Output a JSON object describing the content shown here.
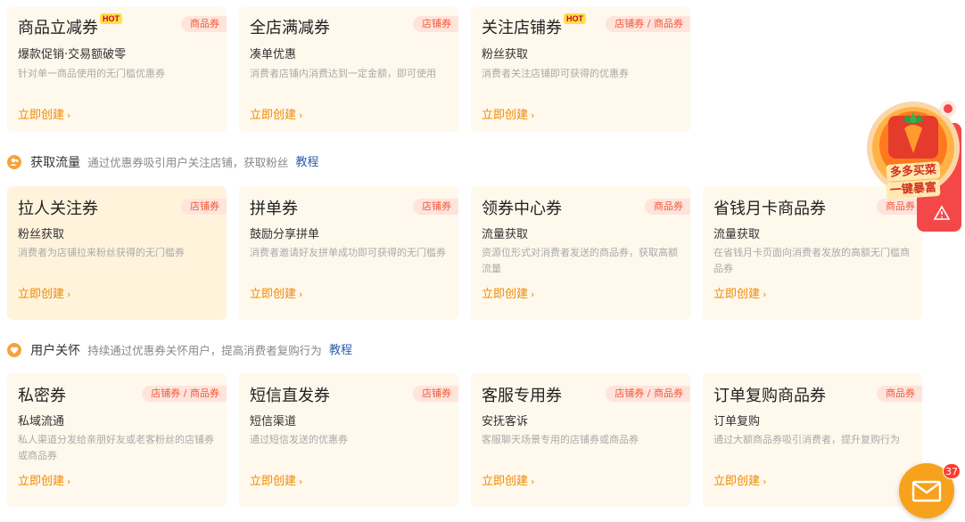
{
  "groups": [
    {
      "cards": [
        {
          "title": "商品立减券",
          "hot": "HOT",
          "tag": "商品券",
          "sub": "爆款促销·交易额破零",
          "desc": "针对单一商品使用的无门槛优惠券",
          "link": "立即创建"
        },
        {
          "title": "全店满减券",
          "hot": "",
          "tag": "店铺券",
          "sub": "凑单优惠",
          "desc": "消费者店铺内消费达到一定金额，即可使用",
          "link": "立即创建"
        },
        {
          "title": "关注店铺券",
          "hot": "HOT",
          "tag": "店铺券 / 商品券",
          "sub": "粉丝获取",
          "desc": "消费者关注店铺即可获得的优惠券",
          "link": "立即创建"
        }
      ]
    },
    {
      "section": {
        "title": "获取流量",
        "desc": "通过优惠券吸引用户关注店铺，获取粉丝",
        "link": "教程"
      },
      "cards": [
        {
          "title": "拉人关注券",
          "hot": "",
          "tag": "店铺券",
          "sub": "粉丝获取",
          "desc": "消费者为店铺拉来粉丝获得的无门槛券",
          "link": "立即创建"
        },
        {
          "title": "拼单券",
          "hot": "",
          "tag": "店铺券",
          "sub": "鼓励分享拼单",
          "desc": "消费者邀请好友拼单成功即可获得的无门槛券",
          "link": "立即创建"
        },
        {
          "title": "领券中心券",
          "hot": "",
          "tag": "商品券",
          "sub": "流量获取",
          "desc": "资源位形式对消费者发送的商品券，获取高额流量",
          "link": "立即创建"
        },
        {
          "title": "省钱月卡商品券",
          "hot": "",
          "tag": "商品券",
          "sub": "流量获取",
          "desc": "在省钱月卡页面向消费者发放的高额无门槛商品券",
          "link": "立即创建"
        }
      ]
    },
    {
      "section": {
        "title": "用户关怀",
        "desc": "持续通过优惠券关怀用户，提高消费者复购行为",
        "link": "教程"
      },
      "cards": [
        {
          "title": "私密券",
          "hot": "",
          "tag": "店铺券 / 商品券",
          "sub": "私域流通",
          "desc": "私人渠道分发给亲朋好友或老客粉丝的店铺券或商品券",
          "link": "立即创建"
        },
        {
          "title": "短信直发券",
          "hot": "",
          "tag": "店铺券",
          "sub": "短信渠道",
          "desc": "通过短信发送的优惠券",
          "link": "立即创建"
        },
        {
          "title": "客服专用券",
          "hot": "",
          "tag": "店铺券 / 商品券",
          "sub": "安抚客诉",
          "desc": "客服聊天场景专用的店铺券或商品券",
          "link": "立即创建"
        },
        {
          "title": "订单复购商品券",
          "hot": "",
          "tag": "商品券",
          "sub": "订单复购",
          "desc": "通过大额商品券吸引消费者，提升复购行为",
          "link": "立即创建"
        }
      ]
    }
  ],
  "promo": {
    "line1": "多多买菜",
    "line2": "一键暴富",
    "icon": "carrot-icon",
    "warn_icon": "warning-icon"
  },
  "mail": {
    "icon": "mail-icon",
    "badge": "37"
  },
  "colors": {
    "card_bg": "#fff8ec",
    "tag_bg": "#ffe4dc",
    "tag_text": "#f05a3c",
    "link": "#f08a00",
    "hot_bg": "#ffe04a",
    "accent": "#f7a23a",
    "tutorial_link": "#2a5db0"
  }
}
